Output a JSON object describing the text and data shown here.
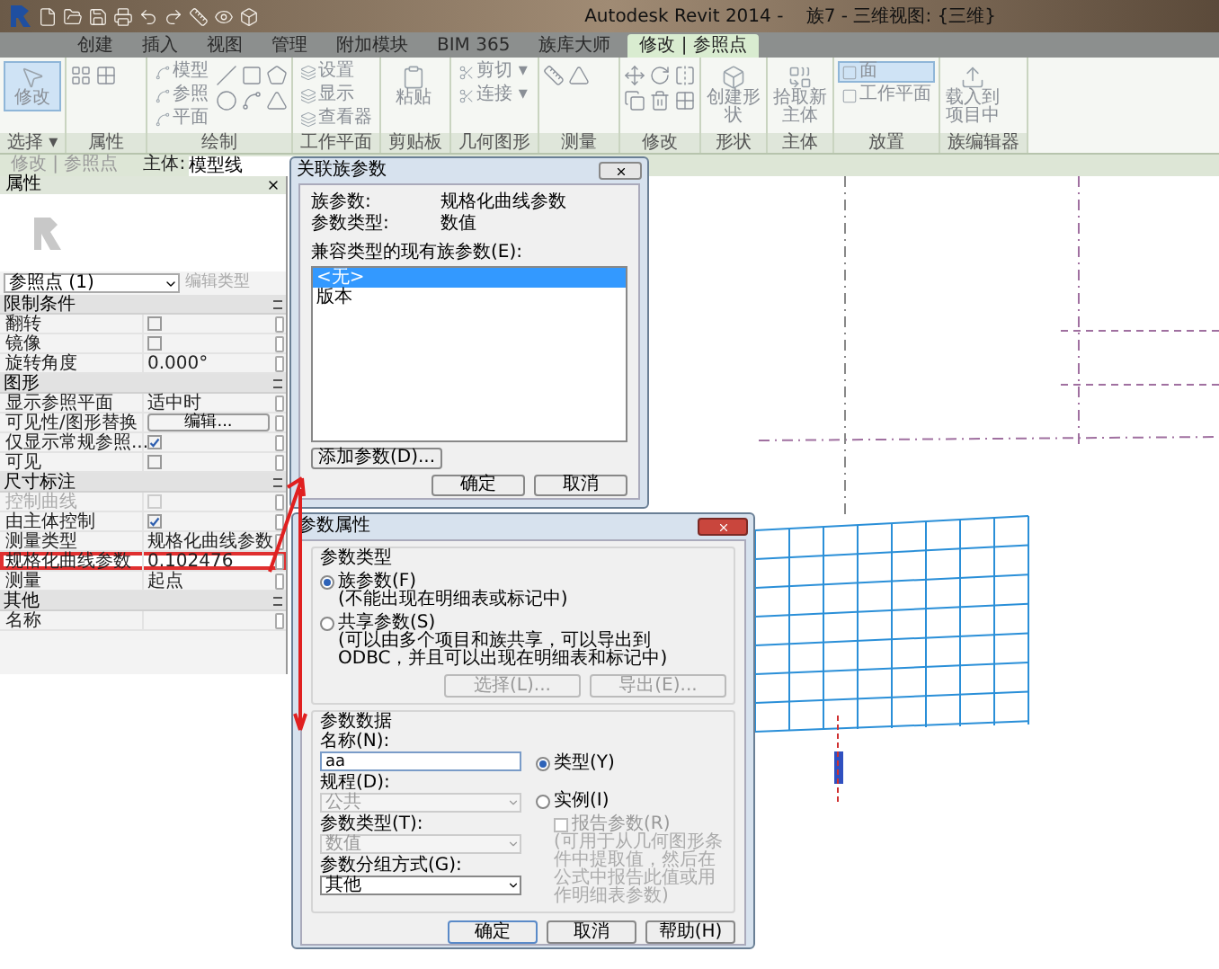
{
  "title_bar": {
    "title": "Autodesk Revit 2014 -    族7 - 三维视图: {三维}"
  },
  "ribbon_tabs": [
    {
      "label": "创建",
      "selected": false
    },
    {
      "label": "插入",
      "selected": false
    },
    {
      "label": "视图",
      "selected": false
    },
    {
      "label": "管理",
      "selected": false
    },
    {
      "label": "附加模块",
      "selected": false
    },
    {
      "label": "BIM 365",
      "selected": false
    },
    {
      "label": "族库大师",
      "selected": false
    },
    {
      "label": "修改 | 参照点",
      "selected": true
    }
  ],
  "ribbon_panels": [
    {
      "kind": "select",
      "title": "选择 ▾",
      "buttons": [
        {
          "label": "修改",
          "selected": true
        }
      ]
    },
    {
      "kind": "properties",
      "title": "属性"
    },
    {
      "kind": "draw",
      "title": "绘制",
      "buttons": [
        {
          "label": "模型",
          "selected": false
        },
        {
          "label": "参照",
          "selected": false
        },
        {
          "label": "平面",
          "selected": false
        }
      ]
    },
    {
      "kind": "workplane",
      "title": "工作平面",
      "buttons": [
        {
          "label": "设置",
          "selected": false
        },
        {
          "label": "显示",
          "selected": false
        },
        {
          "label": "查看器",
          "selected": false
        }
      ]
    },
    {
      "kind": "clipboard",
      "title": "剪贴板",
      "buttons": [
        {
          "label": "粘贴",
          "selected": false
        }
      ]
    },
    {
      "kind": "geometry",
      "title": "几何图形",
      "buttons": [
        {
          "label": "剪切 ▾",
          "selected": false
        },
        {
          "label": "连接 ▾",
          "selected": false
        }
      ]
    },
    {
      "kind": "measure",
      "title": "测量"
    },
    {
      "kind": "modify",
      "title": "修改"
    },
    {
      "kind": "shape",
      "title": "形状",
      "buttons": [
        {
          "label": "创建形状",
          "selected": false
        }
      ]
    },
    {
      "kind": "host",
      "title": "主体",
      "buttons": [
        {
          "label": "拾取新主体",
          "selected": false
        }
      ]
    },
    {
      "kind": "place",
      "title": "放置",
      "buttons": [
        {
          "label": "面",
          "selected": true
        },
        {
          "label": "工作平面",
          "selected": false
        }
      ]
    },
    {
      "kind": "family",
      "title": "族编辑器",
      "buttons": [
        {
          "label": "载入到项目中",
          "selected": false
        }
      ]
    }
  ],
  "options_bar": {
    "context": "修改 | 参照点",
    "host_label": "主体:",
    "host_value": "模型线"
  },
  "properties": {
    "title": "属性",
    "type_selector": "参照点 (1)",
    "edit_type": "编辑类型",
    "sections": [
      {
        "name": "限制条件",
        "rows": [
          {
            "kind": "checkbox",
            "label": "翻转",
            "checked": false,
            "disabled": false,
            "highlighted": false
          },
          {
            "kind": "checkbox",
            "label": "镜像",
            "checked": false,
            "disabled": false,
            "highlighted": false
          },
          {
            "kind": "text",
            "label": "旋转角度",
            "value": "0.000°",
            "highlighted": false
          }
        ]
      },
      {
        "name": "图形",
        "rows": [
          {
            "kind": "text",
            "label": "显示参照平面",
            "value": "适中时",
            "highlighted": false
          },
          {
            "kind": "button",
            "label": "可见性/图形替换",
            "value": "编辑...",
            "highlighted": false
          },
          {
            "kind": "checkbox",
            "label": "仅显示常规参照...",
            "checked": true,
            "disabled": false,
            "highlighted": false
          },
          {
            "kind": "checkbox",
            "label": "可见",
            "checked": false,
            "disabled": false,
            "highlighted": false
          }
        ]
      },
      {
        "name": "尺寸标注",
        "rows": [
          {
            "kind": "checkbox",
            "label": "控制曲线",
            "checked": false,
            "disabled": true,
            "highlighted": false
          },
          {
            "kind": "checkbox",
            "label": "由主体控制",
            "checked": true,
            "disabled": false,
            "highlighted": false
          },
          {
            "kind": "text",
            "label": "测量类型",
            "value": "规格化曲线参数",
            "highlighted": false
          },
          {
            "kind": "text",
            "label": "规格化曲线参数",
            "value": "0.102476",
            "highlighted": true
          },
          {
            "kind": "text",
            "label": "测量",
            "value": "起点",
            "highlighted": false
          }
        ]
      },
      {
        "name": "其他",
        "rows": [
          {
            "kind": "text",
            "label": "名称",
            "highlighted": false
          }
        ]
      }
    ]
  },
  "associate_dialog": {
    "title": "关联族参数",
    "family_parameter_label": "族参数:",
    "family_parameter": "规格化曲线参数",
    "parameter_type_label": "参数类型:",
    "parameter_type": "数值",
    "list_label": "兼容类型的现有族参数(E):",
    "list_items": [
      {
        "label": "<无>",
        "selected": true
      },
      {
        "label": "版本",
        "selected": false
      }
    ],
    "add_button": "添加参数(D)...",
    "ok_button": "确定",
    "cancel_button": "取消"
  },
  "parameter_dialog": {
    "title": "参数属性",
    "type_group": "参数类型",
    "options": [
      {
        "label": "族参数(F)",
        "note": "(不能出现在明细表或标记中)",
        "selected": true
      },
      {
        "label": "共享参数(S)",
        "note": "(可以由多个项目和族共享，可以导出到 ODBC，并且可以出现在明细表和标记中)",
        "selected": false
      }
    ],
    "select_button": "选择(L)...",
    "export_button": "导出(E)...",
    "data_group": "参数数据",
    "name_label": "名称(N):",
    "name_value": "aa",
    "discipline_label": "规程(D):",
    "discipline": "公共",
    "param_type_label": "参数类型(T):",
    "param_type": "数值",
    "group_label": "参数分组方式(G):",
    "group": "其他",
    "scope": [
      {
        "label": "类型(Y)",
        "selected": true
      },
      {
        "label": "实例(I)",
        "selected": false
      }
    ],
    "report_label": "报告参数(R)",
    "report_checked": false,
    "report_note": "(可用于从几何图形条件中提取值，然后在公式中报告此值或用作明细表参数)",
    "ok_button": "确定",
    "cancel_button": "取消",
    "help_button": "帮助(H)"
  }
}
